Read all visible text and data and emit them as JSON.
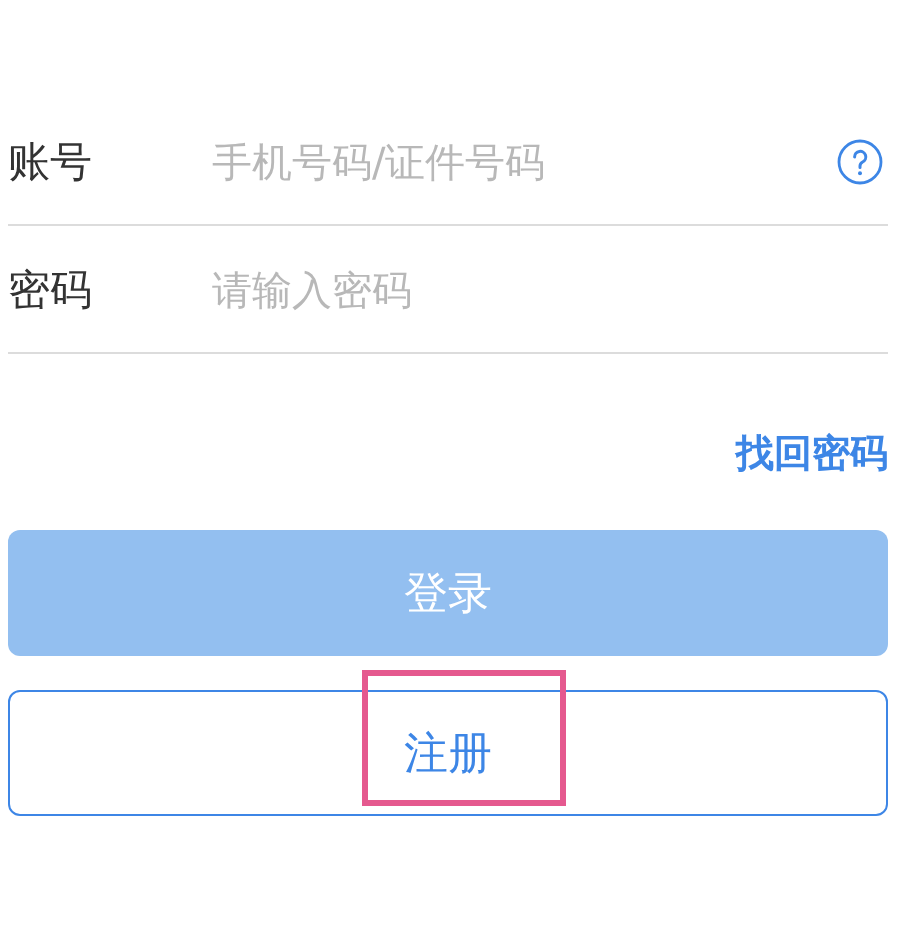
{
  "fields": [
    {
      "label": "账号",
      "placeholder": "手机号码/证件号码",
      "help": true
    },
    {
      "label": "密码",
      "placeholder": "请输入密码",
      "help": false
    }
  ],
  "forgot_link": "找回密码",
  "login_button": {
    "label": "登录",
    "disabled": true
  },
  "register_button": {
    "label": "注册",
    "highlighted": true
  }
}
